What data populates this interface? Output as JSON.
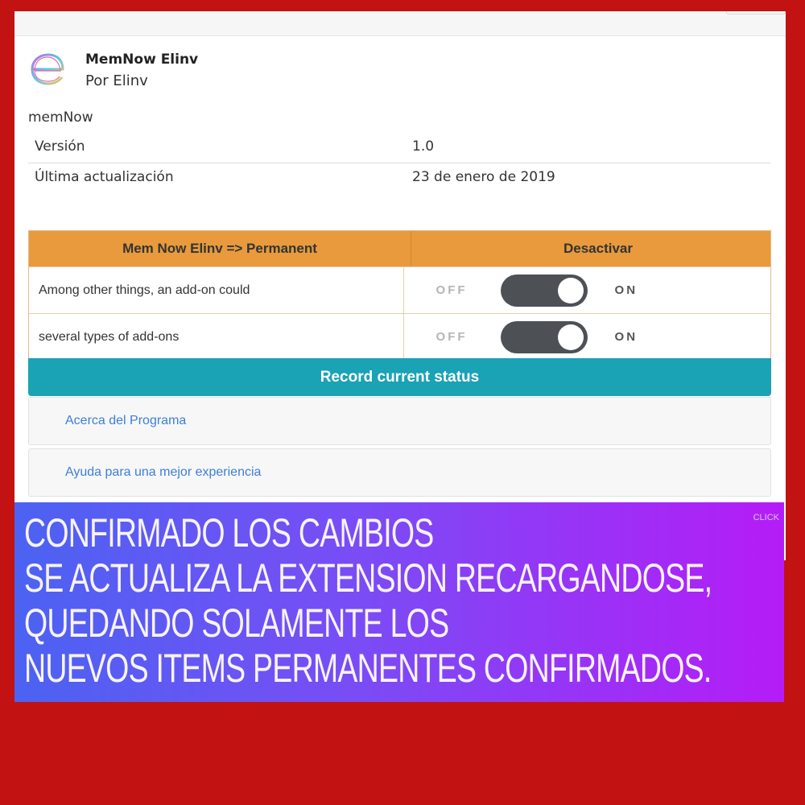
{
  "extension": {
    "name": "MemNow Elinv",
    "author": "Por Elinv",
    "description": "memNow"
  },
  "meta": [
    {
      "key": "Versión",
      "value": "1.0"
    },
    {
      "key": "Última actualización",
      "value": "23 de enero de 2019"
    }
  ],
  "table": {
    "header_left": "Mem Now Elinv => Permanent",
    "header_right": "Desactivar",
    "rows": [
      {
        "label": "Among other things, an add-on could",
        "off": "OFF",
        "on": "ON",
        "state": "on"
      },
      {
        "label": "several types of add-ons",
        "off": "OFF",
        "on": "ON",
        "state": "on"
      }
    ]
  },
  "record_button": "Record current status",
  "links": [
    "Acerca del Programa",
    "Ayuda para una mejor experiencia"
  ],
  "overlay": {
    "click_label": "CLICK",
    "lines": [
      "CONFIRMADO LOS CAMBIOS",
      "SE ACTUALIZA LA EXTENSION RECARGANDOSE,",
      "QUEDANDO SOLAMENTE LOS",
      "NUEVOS ITEMS PERMANENTES CONFIRMADOS."
    ]
  },
  "colors": {
    "background": "#c21212",
    "table_header": "#e89a3c",
    "record_button": "#1aa2b5",
    "link": "#3d7fd8",
    "toggle": "#4d5156"
  },
  "icons": {
    "logo": "extension-e-logo"
  }
}
